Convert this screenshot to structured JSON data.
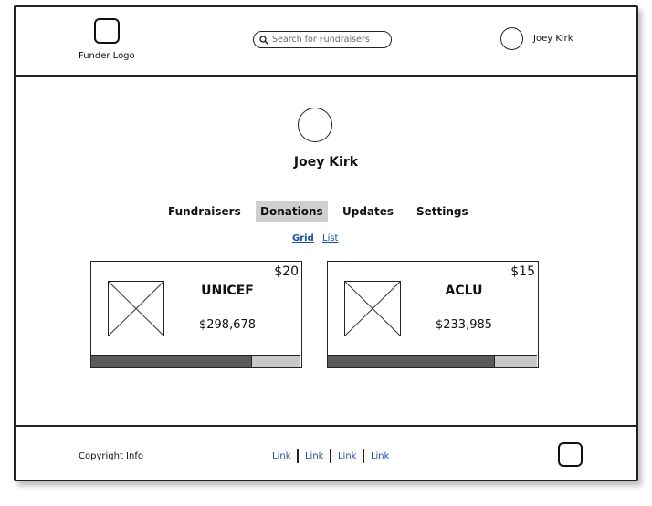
{
  "header": {
    "logo_label": "Funder Logo",
    "search_placeholder": "Search for Fundraisers",
    "user_name": "Joey Kirk"
  },
  "profile": {
    "name": "Joey Kirk"
  },
  "tabs": [
    {
      "label": "Fundraisers",
      "active": false
    },
    {
      "label": "Donations",
      "active": true
    },
    {
      "label": "Updates",
      "active": false
    },
    {
      "label": "Settings",
      "active": false
    }
  ],
  "view_toggle": {
    "grid": "Grid",
    "list": "List",
    "selected": "Grid"
  },
  "cards": [
    {
      "name": "UNICEF",
      "donation": "$20",
      "raised": "$298,678",
      "progress": 0.77
    },
    {
      "name": "ACLU",
      "donation": "$15",
      "raised": "$233,985",
      "progress": 0.8
    }
  ],
  "footer": {
    "copyright": "Copyright Info",
    "links": [
      "Link",
      "Link",
      "Link",
      "Link"
    ]
  }
}
